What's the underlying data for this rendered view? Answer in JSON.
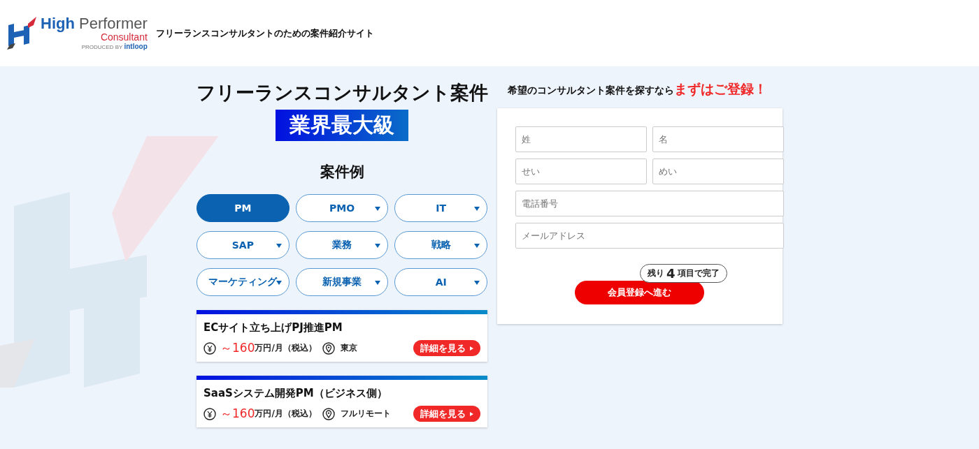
{
  "header": {
    "logo": {
      "word_1": "High",
      "word_2": "Performer",
      "subtitle": "Consultant",
      "produced_by": "PRODUCED BY",
      "brand": "intloop"
    },
    "tagline": "フリーランスコンサルタントのための案件紹介サイト"
  },
  "hero": {
    "title": "フリーランスコンサルタント案件",
    "badge": "業界最大級"
  },
  "examples": {
    "heading": "案件例",
    "categories": [
      {
        "label": "PM",
        "selected": true,
        "has_menu": false
      },
      {
        "label": "PMO",
        "selected": false,
        "has_menu": true
      },
      {
        "label": "IT",
        "selected": false,
        "has_menu": true
      },
      {
        "label": "SAP",
        "selected": false,
        "has_menu": true
      },
      {
        "label": "業務",
        "selected": false,
        "has_menu": true
      },
      {
        "label": "戦略",
        "selected": false,
        "has_menu": true
      },
      {
        "label": "マーケティング",
        "selected": false,
        "has_menu": true
      },
      {
        "label": "新規事業",
        "selected": false,
        "has_menu": true
      },
      {
        "label": "AI",
        "selected": false,
        "has_menu": true
      }
    ],
    "jobs": [
      {
        "title": "ECサイト立ち上げPJ推進PM",
        "salary": "～160",
        "salary_unit": "万円/月（税込）",
        "location": "東京",
        "button": "詳細を見る"
      },
      {
        "title": "SaaSシステム開発PM（ビジネス側）",
        "salary": "～160",
        "salary_unit": "万円/月（税込）",
        "location": "フルリモート",
        "button": "詳細を見る"
      }
    ]
  },
  "signup": {
    "lead": "希望のコンサルタント案件を探すなら",
    "emphasis": "まずはご登録！",
    "fields": [
      {
        "placeholder": "姓",
        "kind": "half"
      },
      {
        "placeholder": "名",
        "kind": "half"
      },
      {
        "placeholder": "せい",
        "kind": "half"
      },
      {
        "placeholder": "めい",
        "kind": "half"
      },
      {
        "placeholder": "電話番号",
        "kind": "full"
      },
      {
        "placeholder": "メールアドレス",
        "kind": "full"
      }
    ],
    "progress": {
      "prefix": "残り",
      "count": "4",
      "suffix": "項目で完了"
    },
    "submit": "会員登録へ進む"
  }
}
